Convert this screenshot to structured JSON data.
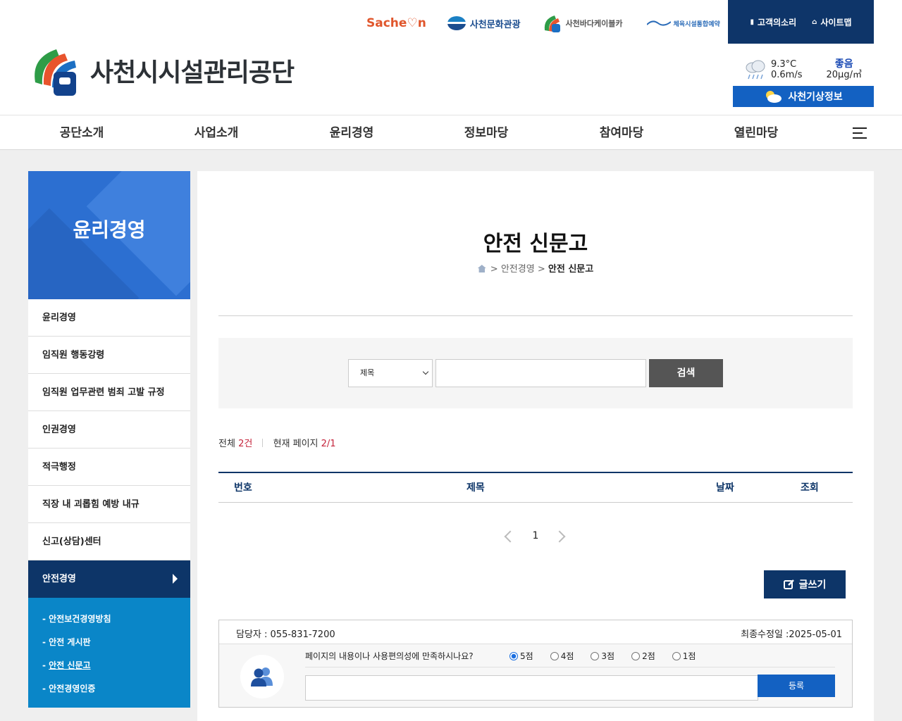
{
  "header": {
    "org_name": "사천시시설관리공단",
    "partners": {
      "sacheon_prefix": "Sache",
      "sacheon_suffix": "n",
      "culture_tourism": "사천문화관광",
      "cablecar": "사천바다케이블카",
      "sports_booking": "체육시설통합예약"
    },
    "util": {
      "voice": "고객의소리",
      "sitemap": "사이트맵"
    },
    "weather": {
      "temp": "9.3°C",
      "wind": "0.6m/s",
      "air_status": "좋음",
      "air_value": "20μg/㎥",
      "button": "사천기상정보"
    }
  },
  "gnb": [
    "공단소개",
    "사업소개",
    "윤리경영",
    "정보마당",
    "참여마당",
    "열린마당"
  ],
  "lnb": {
    "title": "윤리경영",
    "items": [
      "윤리경영",
      "임직원 행동강령",
      "임직원 업무관련 범죄 고발 규정",
      "인권경영",
      "적극행정",
      "직장 내 괴롭힘 예방 내규",
      "신고(상담)센터",
      "안전경영"
    ],
    "sub_items": [
      "안전보건경영방침",
      "안전 게시판",
      "안전 신문고",
      "안전경영인증"
    ]
  },
  "main": {
    "title": "안전 신문고",
    "breadcrumb": {
      "sep1": ">",
      "parent": "안전경영",
      "sep2": ">",
      "current": "안전 신문고"
    },
    "search": {
      "select_value": "제목",
      "button": "검색"
    },
    "count": {
      "total_label": "전체",
      "total_value": "2건",
      "page_label": "현재 페이지",
      "page_value": "2/1"
    },
    "table_headers": [
      "번호",
      "제목",
      "날짜",
      "조회"
    ],
    "paging": {
      "current": "1"
    },
    "write_button": "글쓰기"
  },
  "survey": {
    "manager": "담당자 : 055-831-7200",
    "updated": "최종수정일 :2025-05-01",
    "question": "페이지의 내용이나 사용편의성에 만족하시나요?",
    "options": [
      "5점",
      "4점",
      "3점",
      "2점",
      "1점"
    ],
    "selected": "5점",
    "submit": "등록"
  },
  "colors": {
    "navy": "#0d3568",
    "blue": "#1361c2",
    "lnb_title": "#2c6fd1",
    "lnb_sub": "#0a86c8",
    "accent_red": "#c4233b"
  }
}
